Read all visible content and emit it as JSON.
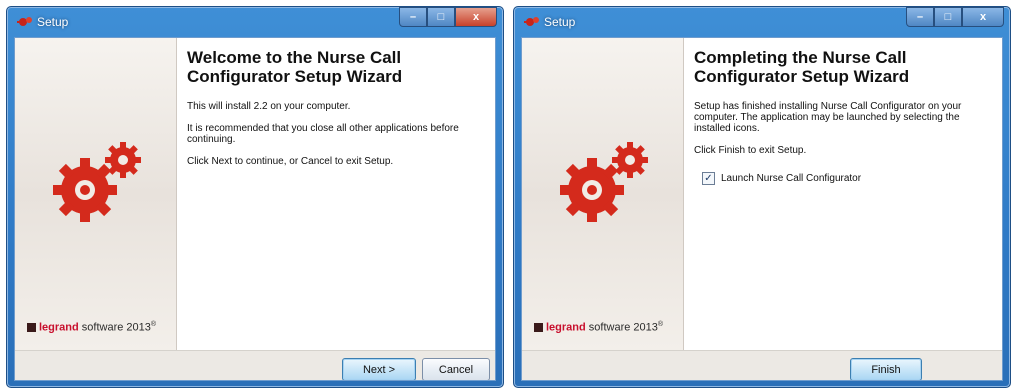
{
  "left_window": {
    "title": "Setup",
    "heading": "Welcome to the Nurse Call Configurator Setup Wizard",
    "paragraphs": [
      "This will install 2.2 on your computer.",
      "It is recommended that you close all other applications before continuing.",
      "Click Next to continue, or Cancel to exit Setup."
    ],
    "brand": {
      "logo_text": "legrand",
      "suffix": "software 2013",
      "mark": "®"
    },
    "buttons": {
      "next": "Next >",
      "cancel": "Cancel"
    }
  },
  "right_window": {
    "title": "Setup",
    "heading": "Completing the Nurse Call Configurator Setup Wizard",
    "paragraphs": [
      "Setup has finished installing Nurse Call Configurator on your computer. The application may be launched by selecting the installed icons.",
      "Click Finish to exit Setup."
    ],
    "checkbox": {
      "label": "Launch Nurse Call Configurator",
      "checked": true,
      "mark": "✓"
    },
    "brand": {
      "logo_text": "legrand",
      "suffix": "software 2013",
      "mark": "®"
    },
    "buttons": {
      "finish": "Finish"
    }
  },
  "window_controls": {
    "minimize": "–",
    "maximize": "□",
    "close": "x"
  },
  "icons": {
    "app": "setup-app-icon",
    "banner": "gears-icon"
  },
  "colors": {
    "titlebar": "#2f7ac6",
    "brand_red": "#c8102e",
    "gear_red": "#d42a1c"
  }
}
